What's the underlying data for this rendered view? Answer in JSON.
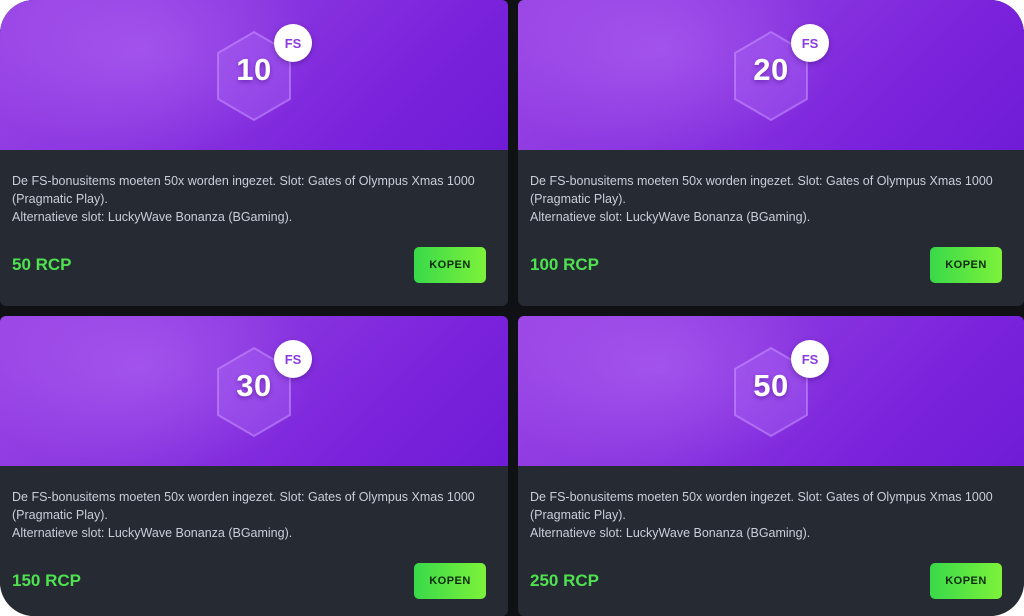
{
  "cards": [
    {
      "count": "10",
      "chip": "FS",
      "desc_line1": "De FS-bonusitems moeten 50x worden ingezet. Slot: Gates of Olympus Xmas 1000",
      "desc_line2": "(Pragmatic Play).",
      "desc_line3": "Alternatieve slot: LuckyWave Bonanza (BGaming).",
      "price": "50 RCP",
      "button": "KOPEN"
    },
    {
      "count": "20",
      "chip": "FS",
      "desc_line1": "De FS-bonusitems moeten 50x worden ingezet. Slot: Gates of Olympus Xmas 1000",
      "desc_line2": "(Pragmatic Play).",
      "desc_line3": "Alternatieve slot: LuckyWave Bonanza (BGaming).",
      "price": "100 RCP",
      "button": "KOPEN"
    },
    {
      "count": "30",
      "chip": "FS",
      "desc_line1": "De FS-bonusitems moeten 50x worden ingezet. Slot: Gates of Olympus Xmas 1000",
      "desc_line2": "(Pragmatic Play).",
      "desc_line3": "Alternatieve slot: LuckyWave Bonanza (BGaming).",
      "price": "150 RCP",
      "button": "KOPEN"
    },
    {
      "count": "50",
      "chip": "FS",
      "desc_line1": "De FS-bonusitems moeten 50x worden ingezet. Slot: Gates of Olympus Xmas 1000",
      "desc_line2": "(Pragmatic Play).",
      "desc_line3": "Alternatieve slot: LuckyWave Bonanza (BGaming).",
      "price": "250 RCP",
      "button": "KOPEN"
    }
  ],
  "colors": {
    "hero_gradient_start": "#9a45e6",
    "hero_gradient_end": "#6f1cd6",
    "card_background": "#252a33",
    "price_green": "#4ee24f",
    "button_gradient_start": "#39d94a",
    "button_gradient_end": "#7df23a",
    "chip_text": "#8a3ce0"
  },
  "icons": {
    "badge": "hexagon-badge-icon"
  }
}
